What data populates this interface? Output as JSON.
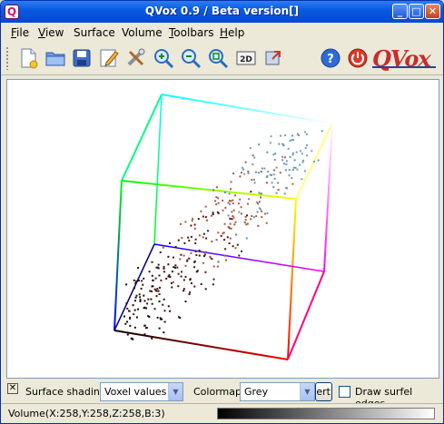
{
  "window": {
    "title": "QVox 0.9 / Beta version[]",
    "app_icon_letter": "Q",
    "min_glyph": "_",
    "max_glyph": "□",
    "close_glyph": "✕"
  },
  "menu": [
    {
      "accel": "F",
      "rest": "ile"
    },
    {
      "accel": "V",
      "rest": "iew"
    },
    {
      "accel": "",
      "rest": "Surface"
    },
    {
      "accel": "",
      "rest": "Volume"
    },
    {
      "accel": "T",
      "rest": "oolbars"
    },
    {
      "accel": "H",
      "rest": "elp"
    }
  ],
  "toolbar": {
    "icons": [
      "new-file-icon",
      "open-folder-icon",
      "save-icon",
      "edit-icon",
      "tools-icon",
      "zoom-in-icon",
      "zoom-out-icon",
      "zoom-fit-icon",
      "2d-view-icon",
      "export-icon",
      "help-icon",
      "power-icon"
    ],
    "view_2d_label": "2D",
    "help_glyph": "?",
    "logo_text": "QVox"
  },
  "controls": {
    "close_glyph": "✕",
    "surface_shading_label": "Surface shading",
    "surface_shading_value": "Voxel values",
    "colormap_label": "Colormap",
    "colormap_value": "Grey",
    "invert_button_label": "Invert",
    "draw_surfel_edges_label": "Draw surfel edges",
    "draw_surfel_edges_checked": false
  },
  "status": {
    "text": "Volume(X:258,Y:258,Z:258,B:3)"
  },
  "colors": {
    "title_bar": "#0a5ae2",
    "logo_red": "#c82c2c",
    "logo_blue": "#2d3f96"
  }
}
